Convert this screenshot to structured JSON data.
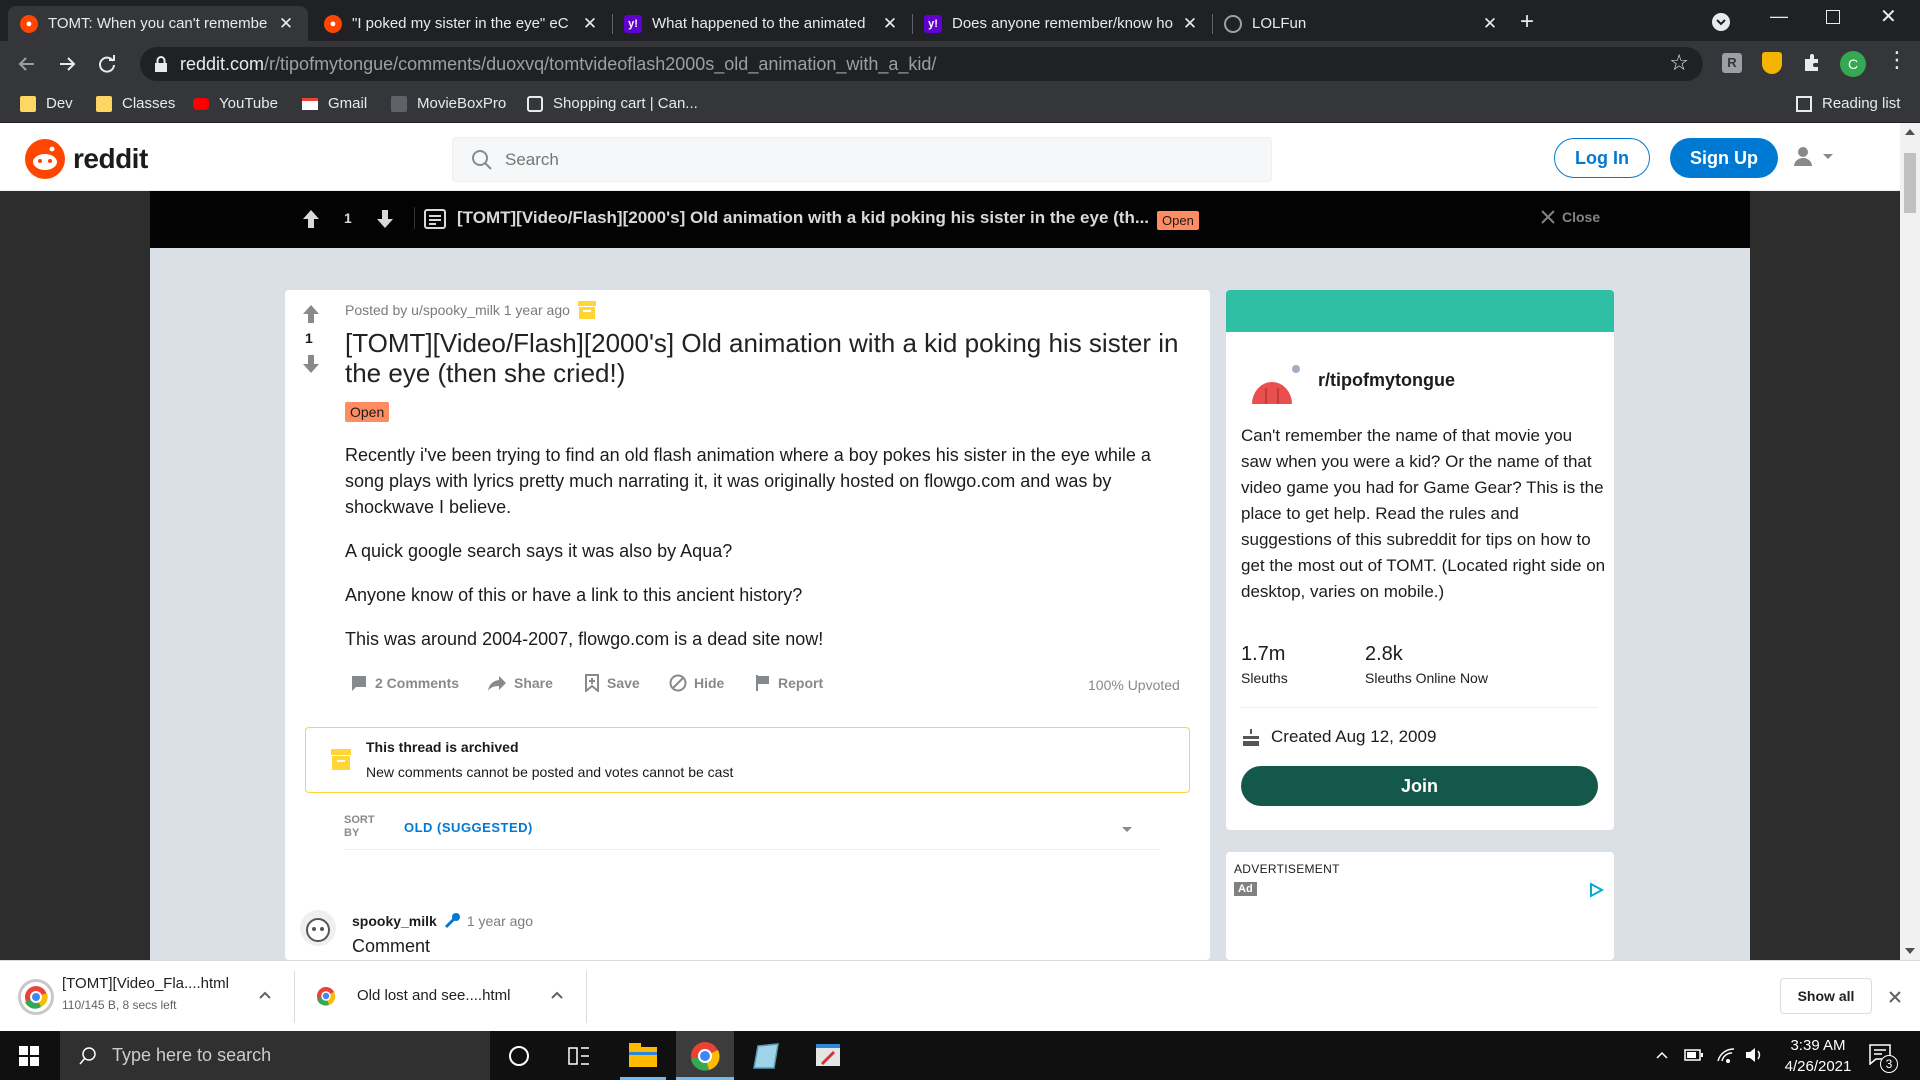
{
  "browser": {
    "tabs": [
      {
        "title": "TOMT: When you can't remembe",
        "favicon": "reddit-icon",
        "active": true
      },
      {
        "title": "\"I poked my sister in the eye\" eC",
        "favicon": "reddit-icon",
        "active": false
      },
      {
        "title": "What happened to the animated",
        "favicon": "yahoo-answers-icon",
        "active": false
      },
      {
        "title": "Does anyone remember/know ho",
        "favicon": "yahoo-answers-icon",
        "active": false
      },
      {
        "title": "LOLFun",
        "favicon": "globe-icon",
        "active": false
      }
    ],
    "url_domain": "reddit.com",
    "url_path": "/r/tipofmytongue/comments/duoxvq/tomtvideoflash2000s_old_animation_with_a_kid/",
    "profile_initial": "C",
    "bookmarks": [
      {
        "label": "Dev",
        "icon": "folder-icon"
      },
      {
        "label": "Classes",
        "icon": "folder-icon"
      },
      {
        "label": "YouTube",
        "icon": "youtube-icon"
      },
      {
        "label": "Gmail",
        "icon": "gmail-icon"
      },
      {
        "label": "MovieBoxPro",
        "icon": "moviebox-icon"
      },
      {
        "label": "Shopping cart | Can...",
        "icon": "cart-icon"
      }
    ],
    "reading_list": "Reading list"
  },
  "reddit": {
    "logo_text": "reddit",
    "search_placeholder": "Search",
    "login_label": "Log In",
    "signup_label": "Sign Up"
  },
  "sticky": {
    "votes": "1",
    "title": "[TOMT][Video/Flash][2000's] Old animation with a kid poking his sister in the eye (th...",
    "flair": "Open",
    "close_label": "Close"
  },
  "post": {
    "votes": "1",
    "meta_prefix": "Posted by",
    "author": "u/spooky_milk",
    "time": "1 year ago",
    "title": "[TOMT][Video/Flash][2000's] Old animation with a kid poking his sister in the eye (then she cried!)",
    "flair": "Open",
    "body": [
      "Recently i've been trying to find an old flash animation where a boy pokes his sister in the eye while a song plays with lyrics pretty much narrating it, it was originally hosted on flowgo.com and was by shockwave I believe.",
      "A quick google search says it was also by Aqua?",
      "Anyone know of this or have a link to this ancient history?",
      "This was around 2004-2007, flowgo.com is a dead site now!"
    ],
    "actions": {
      "comments": "2 Comments",
      "share": "Share",
      "save": "Save",
      "hide": "Hide",
      "report": "Report"
    },
    "upvoted": "100% Upvoted",
    "archived_title": "This thread is archived",
    "archived_text": "New comments cannot be posted and votes cannot be cast",
    "sort_label": "SORT BY",
    "sort_value": "OLD (SUGGESTED)"
  },
  "comment": {
    "author": "spooky_milk",
    "time": "1 year ago",
    "text": "Comment"
  },
  "sidebar": {
    "subreddit": "r/tipofmytongue",
    "description": "Can't remember the name of that movie you saw when you were a kid? Or the name of that video game you had for Game Gear? This is the place to get help. Read the rules and suggestions of this subreddit for tips on how to get the most out of TOMT. (Located right side on desktop, varies on mobile.)",
    "members": "1.7m",
    "members_label": "Sleuths",
    "online": "2.8k",
    "online_label": "Sleuths Online Now",
    "created": "Created Aug 12, 2009",
    "join_label": "Join",
    "ad_label": "ADVERTISEMENT",
    "ad_badge": "Ad"
  },
  "downloads": {
    "items": [
      {
        "name": "[TOMT][Video_Fla....html",
        "status": "110/145 B, 8 secs left"
      },
      {
        "name": "Old lost and see....html",
        "status": ""
      }
    ],
    "show_all": "Show all"
  },
  "taskbar": {
    "search_placeholder": "Type here to search",
    "time": "3:39 AM",
    "date": "4/26/2021",
    "notifications": "3"
  },
  "colors": {
    "reddit_orange": "#ff4500",
    "reddit_blue": "#0079d3",
    "tomt_teal": "#2ebfa5",
    "join_green": "#14574b",
    "flair_orange": "#ff8b60",
    "archive_yellow": "#ffd635"
  }
}
